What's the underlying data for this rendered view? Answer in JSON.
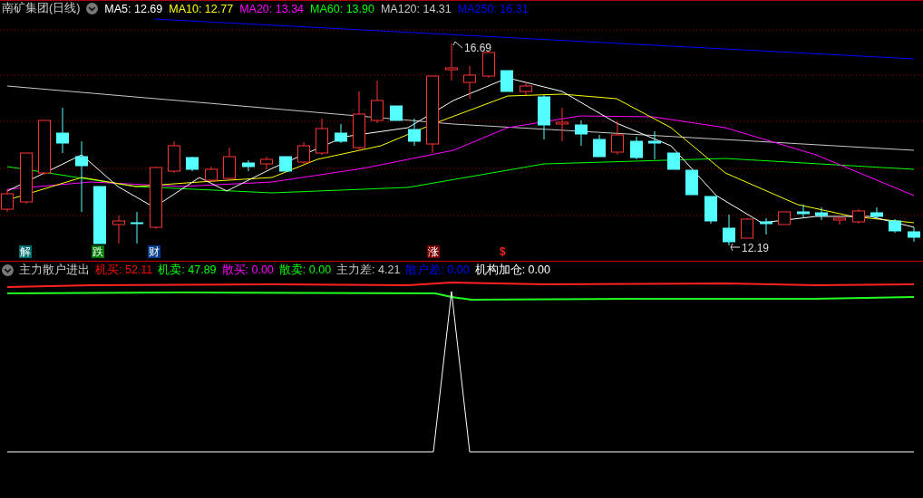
{
  "chart_header": {
    "title": "南矿集团(日线)",
    "indicators": [
      {
        "label": "MA5: 12.69",
        "color": "#ffffff"
      },
      {
        "label": "MA10: 12.77",
        "color": "#ffff00"
      },
      {
        "label": "MA20: 13.34",
        "color": "#ff00ff"
      },
      {
        "label": "MA60: 13.90",
        "color": "#00ff00"
      },
      {
        "label": "MA120: 14.31",
        "color": "#c8c8c8"
      },
      {
        "label": "MA250: 16.31",
        "color": "#0000ff"
      }
    ]
  },
  "price_chart": {
    "high_label": "16.69",
    "low_label": "12.19"
  },
  "markers": [
    {
      "text": "解",
      "color": "#006e6e"
    },
    {
      "text": "跌",
      "color": "#007800"
    },
    {
      "text": "财",
      "color": "#003c8c"
    },
    {
      "text": "涨",
      "color": "#780000"
    },
    {
      "text": "$",
      "color": "#000000"
    }
  ],
  "indicator_header": {
    "title": "主力散户进出",
    "items": [
      {
        "label": "机买: 52.11",
        "color": "#ff0000"
      },
      {
        "label": "机卖: 47.89",
        "color": "#00ff00"
      },
      {
        "label": "散买: 0.00",
        "color": "#ff00ff"
      },
      {
        "label": "散卖: 0.00",
        "color": "#00ff00"
      },
      {
        "label": "主力差: 4.21",
        "color": "#c8c8c8"
      },
      {
        "label": "散户差: 0.00",
        "color": "#0000ff"
      },
      {
        "label": "机构加仓: 0.00",
        "color": "#ffffff"
      }
    ]
  }
}
